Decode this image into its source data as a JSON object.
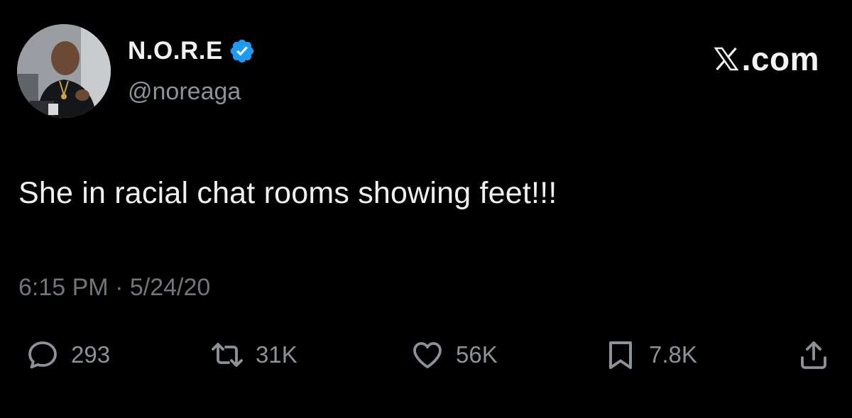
{
  "author": {
    "display_name": "N.O.R.E",
    "handle": "@noreaga",
    "verified": true,
    "badge_color": "#1d9bf0"
  },
  "brand": {
    "text": ".com",
    "logo_icon": "x-logo-icon"
  },
  "tweet": {
    "text": "She in racial chat rooms showing feet!!!",
    "timestamp": "6:15 PM · 5/24/20"
  },
  "actions": {
    "replies": "293",
    "retweets": "31K",
    "likes": "56K",
    "bookmarks": "7.8K"
  },
  "icons": {
    "reply": "reply-icon",
    "retweet": "retweet-icon",
    "like": "heart-icon",
    "bookmark": "bookmark-icon",
    "share": "share-icon"
  },
  "colors": {
    "background": "#000000",
    "text_primary": "#e7e9ea",
    "text_secondary": "#71767b",
    "icon": "#8b9298"
  }
}
